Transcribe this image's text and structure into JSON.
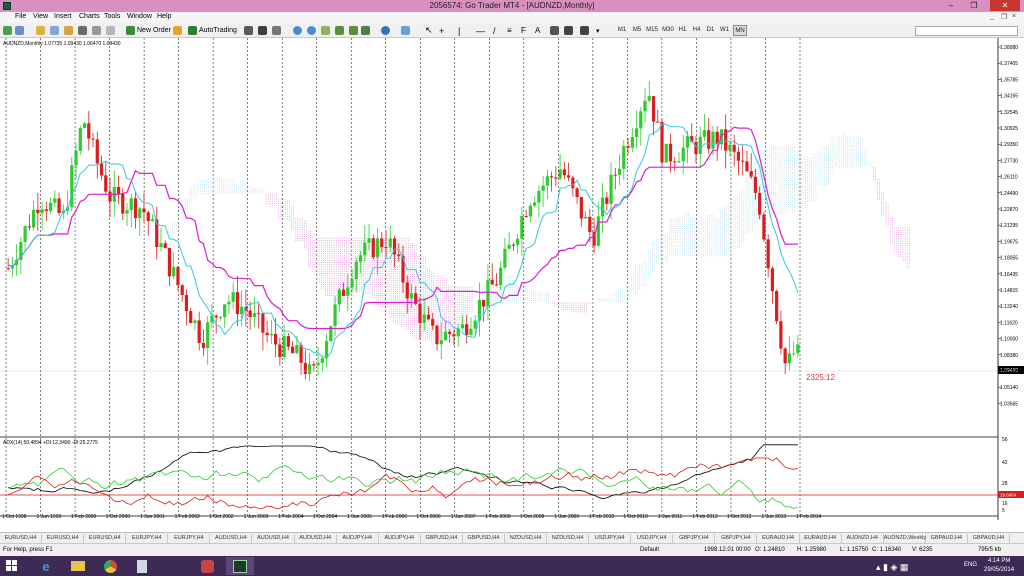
{
  "window": {
    "title": "2056574: Go Trader MT4 - [AUDNZD,Monthly]",
    "minimize": "–",
    "restore": "❒",
    "close": "✕"
  },
  "menu": {
    "items": [
      "File",
      "View",
      "Insert",
      "Charts",
      "Tools",
      "Window",
      "Help"
    ],
    "mdi_controls": [
      "_",
      "❐",
      "×"
    ]
  },
  "toolbar": {
    "new_order_label": "New Order",
    "autotrading_label": "AutoTrading",
    "timeframes": [
      "M1",
      "M5",
      "M15",
      "M30",
      "H1",
      "H4",
      "D1",
      "W1",
      "MN"
    ],
    "active_timeframe": "MN"
  },
  "chart": {
    "header": "AUDNZD,Monthly  1.07735 1.09430 1.06470 1.09430",
    "countdown": "2325:12",
    "current_price": "1.09430",
    "price_labels": [
      "1.38980",
      "1.37405",
      "1.35785",
      "1.34165",
      "1.32545",
      "1.30925",
      "1.29350",
      "1.27730",
      "1.26110",
      "1.24490",
      "1.22870",
      "1.21295",
      "1.19675",
      "1.18055",
      "1.16435",
      "1.14815",
      "1.13240",
      "1.11620",
      "1.10000",
      "1.08380",
      "1.06760",
      "1.05140",
      "1.03565"
    ],
    "indicator_header": "ADX(14) 50.4894 +DI:12.3490 -DI:25.2775",
    "indicator_labels": [
      "56",
      "42",
      "28",
      "19.6664",
      "16",
      "5"
    ],
    "indicator_level": "19.6664",
    "time_labels": [
      "1 Oct 1998",
      "1 Jun 1999",
      "1 Feb 2000",
      "1 Oct 2000",
      "1 Jun 2001",
      "1 Feb 2002",
      "1 Oct 2002",
      "1 Jun 2003",
      "1 Feb 2004",
      "1 Oct 2004",
      "1 Jun 2005",
      "1 Feb 2006",
      "1 Oct 2006",
      "1 Jun 2007",
      "1 Feb 2008",
      "1 Oct 2008",
      "1 Jun 2009",
      "1 Feb 2010",
      "1 Oct 2010",
      "1 Jun 2011",
      "1 Feb 2012",
      "1 Oct 2012",
      "1 Jun 2013",
      "1 Feb 2014"
    ],
    "colors": {
      "bull": "#2ecc2e",
      "bear": "#d81e1e",
      "tenkan": "#38c8d8",
      "kijun": "#d81ed0",
      "cloud_bull": "#9fd4e6",
      "cloud_bear": "#d881d0",
      "adx": "#000000",
      "plus_di": "#2ecc2e",
      "minus_di": "#d81e1e",
      "countdown": "#d43a3a"
    }
  },
  "tabs": [
    "EURUSD,H4",
    "EURUSD,H4",
    "EURUSD,H4",
    "EURJPY,H4",
    "EURJPY,H4",
    "AUDUSD,H4",
    "AUDUSD,H4",
    "AUDUSD,H4",
    "AUDJPY,H4",
    "AUDJPY,H4",
    "GBPUSD,H4",
    "GBPUSD,H4",
    "NZDUSD,H4",
    "NZDUSD,H4",
    "USDJPY,H4",
    "USDJPY,H4",
    "GBPJPY,H4",
    "GBPJPY,H4",
    "EURAUD,H4",
    "EURAUD,H4",
    "AUDNZD,H4",
    "AUDNZD,Weekly",
    "GBPAUD,H4",
    "GBPAUD,H4"
  ],
  "status": {
    "help": "For Help, press F1",
    "profile": "Default",
    "datetime": "1998.12.01 00:00",
    "open": "O: 1.24810",
    "high": "H: 1.25980",
    "low": "L: 1.15750",
    "close": "C: 1.16340",
    "volume": "V: 6235",
    "traffic": "795/5 kb"
  },
  "taskbar": {
    "time": "4:14 PM",
    "date": "29/05/2014",
    "lang": "ENG",
    "items": [
      "ie-icon",
      "folder-icon",
      "chrome-icon",
      "calculator-icon",
      "paint-icon",
      "mt4-icon"
    ]
  }
}
